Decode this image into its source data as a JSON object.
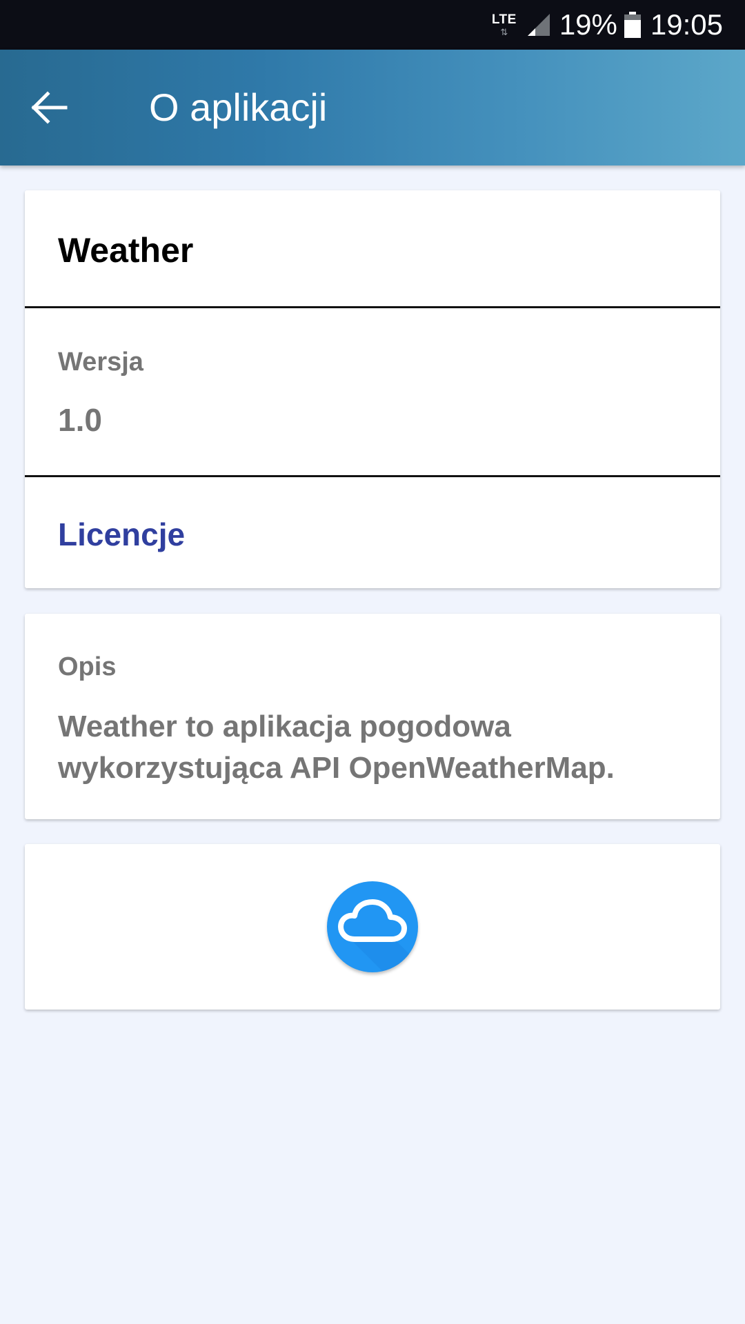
{
  "status_bar": {
    "network": "LTE",
    "battery": "19%",
    "time": "19:05",
    "icons": [
      "lte-icon",
      "signal-icon",
      "battery-icon"
    ]
  },
  "app_bar": {
    "title": "O aplikacji",
    "back_icon": "arrow-back-icon"
  },
  "info_card": {
    "app_name": "Weather",
    "version_label": "Wersja",
    "version_value": "1.0",
    "licenses_label": "Licencje"
  },
  "description_card": {
    "label": "Opis",
    "text": "Weather to aplikacja pogodowa wykorzystująca API OpenWeatherMap."
  },
  "logo_card": {
    "icon": "cloud-icon"
  },
  "colors": {
    "status_bar": "#0c0d15",
    "app_bar_start": "#286a91",
    "app_bar_end": "#5ca7c9",
    "background": "#f0f4fd",
    "link": "#303f9f",
    "secondary_text": "#757575",
    "logo": "#2196f3"
  }
}
